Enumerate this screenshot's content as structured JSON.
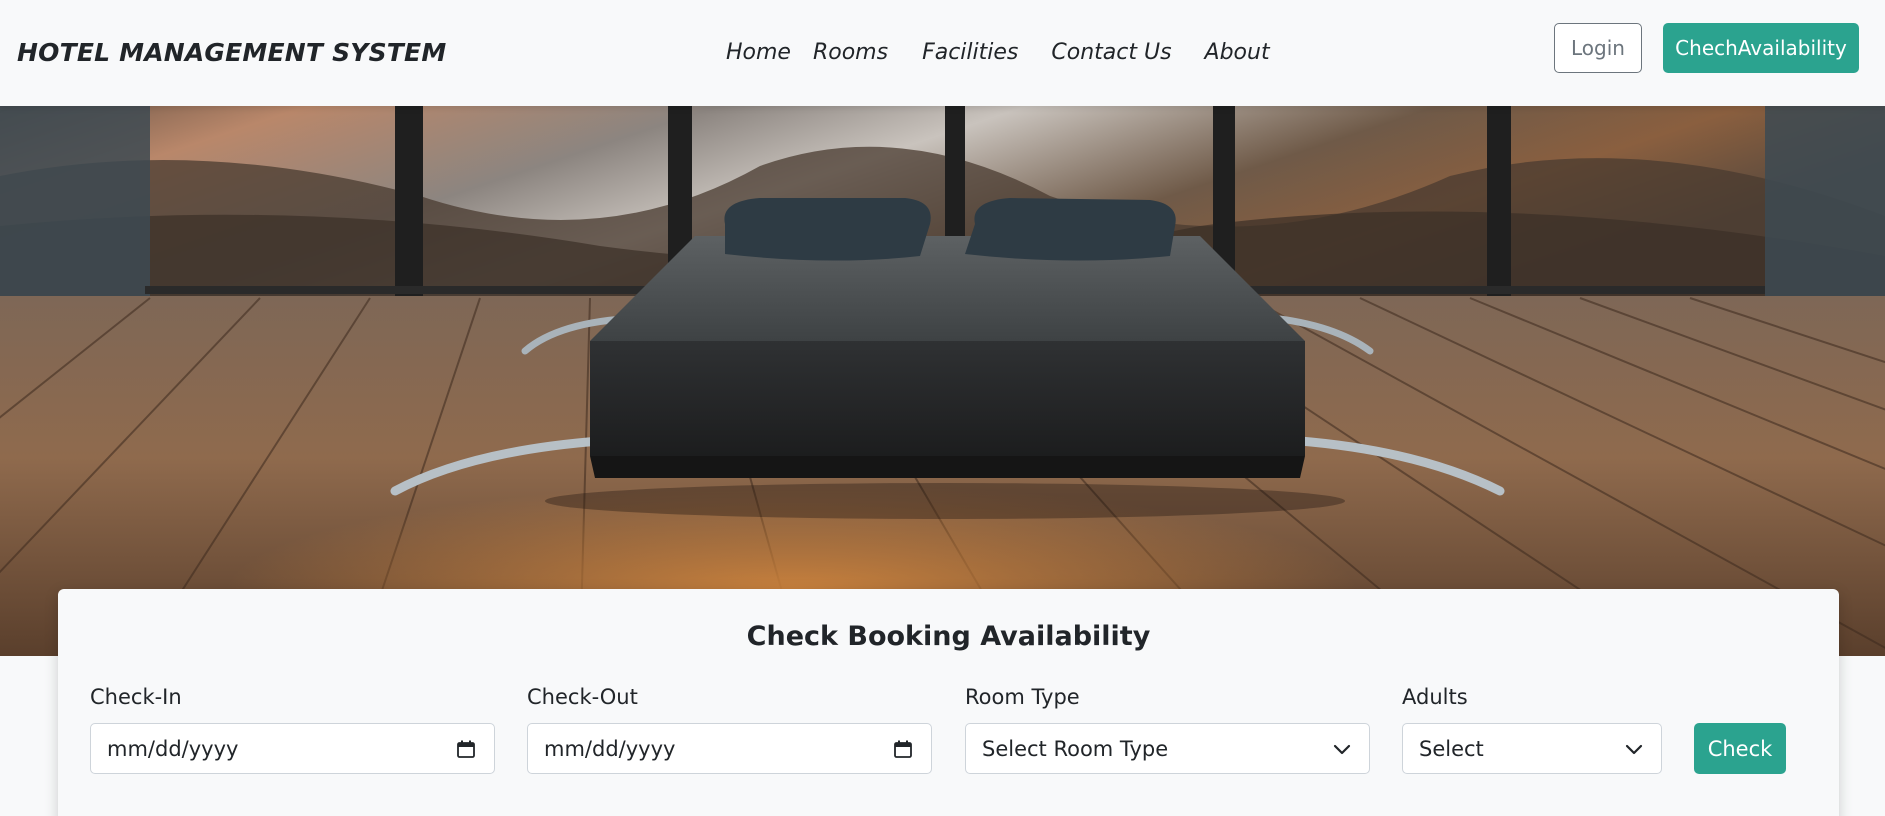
{
  "navbar": {
    "brand": "HOTEL MANAGEMENT SYSTEM",
    "links": [
      {
        "label": "Home"
      },
      {
        "label": "Rooms"
      },
      {
        "label": "Facilities"
      },
      {
        "label": "Contact Us"
      },
      {
        "label": "About"
      }
    ],
    "login_label": "Login",
    "availability_label": "ChechAvailability"
  },
  "hero": {
    "image_icon": "hotel-room-hero-image"
  },
  "booking": {
    "title": "Check Booking Availability",
    "check_in": {
      "label": "Check-In",
      "value": "mm/dd/yyyy",
      "icon": "calendar-icon"
    },
    "check_out": {
      "label": "Check-Out",
      "value": "mm/dd/yyyy",
      "icon": "calendar-icon"
    },
    "room_type": {
      "label": "Room Type",
      "value": "Select Room Type",
      "icon": "chevron-down-icon"
    },
    "adults": {
      "label": "Adults",
      "value": "Select",
      "icon": "chevron-down-icon"
    },
    "check_label": "Check"
  },
  "colors": {
    "accent": "#2ba38f",
    "background": "#f8f9fa",
    "text": "#212529",
    "muted": "#6c757d"
  }
}
